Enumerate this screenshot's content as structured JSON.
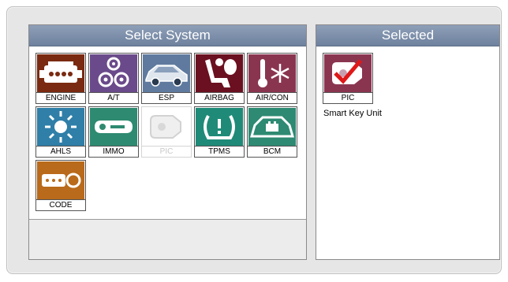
{
  "left_panel": {
    "title": "Select System"
  },
  "right_panel": {
    "title": "Selected",
    "selected": {
      "label": "PIC",
      "description": "Smart Key Unit",
      "icon": "smart-key-check-icon"
    }
  },
  "systems": [
    {
      "label": "ENGINE",
      "icon": "engine-icon",
      "color": "#7a2a10",
      "enabled": true
    },
    {
      "label": "A/T",
      "icon": "gears-icon",
      "color": "#6a4a8a",
      "enabled": true
    },
    {
      "label": "ESP",
      "icon": "car-icon",
      "color": "#5f7a9e",
      "enabled": true
    },
    {
      "label": "AIRBAG",
      "icon": "airbag-seat-icon",
      "color": "#6b1020",
      "enabled": true
    },
    {
      "label": "AIR/CON",
      "icon": "thermometer-snowflake-icon",
      "color": "#8a3550",
      "enabled": true
    },
    {
      "label": "AHLS",
      "icon": "headlamp-icon",
      "color": "#2f7fa8",
      "enabled": true
    },
    {
      "label": "IMMO",
      "icon": "key-icon",
      "color": "#2e8a70",
      "enabled": true
    },
    {
      "label": "PIC",
      "icon": "smart-key-icon",
      "color": "#cfcfcf",
      "enabled": false
    },
    {
      "label": "TPMS",
      "icon": "tire-pressure-icon",
      "color": "#1f8a78",
      "enabled": true
    },
    {
      "label": "BCM",
      "icon": "car-battery-icon",
      "color": "#2e8a72",
      "enabled": true
    },
    {
      "label": "CODE",
      "icon": "key-code-icon",
      "color": "#b96a1a",
      "enabled": true
    }
  ]
}
